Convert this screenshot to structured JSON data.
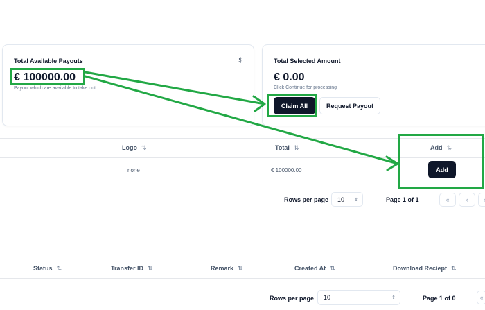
{
  "payouts_card": {
    "title": "Total Available Payouts",
    "currency_icon": "$",
    "amount": "€ 100000.00",
    "subtitle": "Payout which are available to take out."
  },
  "selected_card": {
    "title": "Total Selected Amount",
    "amount": "€ 0.00",
    "subtitle": "Click Continue for processing",
    "claim_all_label": "Claim All",
    "request_payout_label": "Request Payout"
  },
  "payout_table": {
    "headers": {
      "logo": "Logo",
      "total": "Total",
      "add": "Add"
    },
    "sort_icon": "⇅",
    "row": {
      "logo": "none",
      "total": "€ 100000.00",
      "add_label": "Add"
    },
    "rows_per_page_label": "Rows per page",
    "rows_per_page_value": "10",
    "page_info": "Page 1 of 1"
  },
  "transfers_table": {
    "headers": {
      "status": "Status",
      "transfer_id": "Transfer ID",
      "remark": "Remark",
      "created_at": "Created At",
      "download_receipt": "Download Reciept"
    },
    "rows_per_page_label": "Rows per page",
    "rows_per_page_value": "10",
    "page_info": "Page 1 of 0"
  },
  "colors": {
    "accent": "#22a845",
    "button_dark": "#0f172a"
  },
  "icons": [
    "dollar-icon",
    "sort-icon",
    "chevron-updown-icon",
    "first-page-icon",
    "prev-page-icon",
    "next-page-icon",
    "arrow-annotation"
  ]
}
